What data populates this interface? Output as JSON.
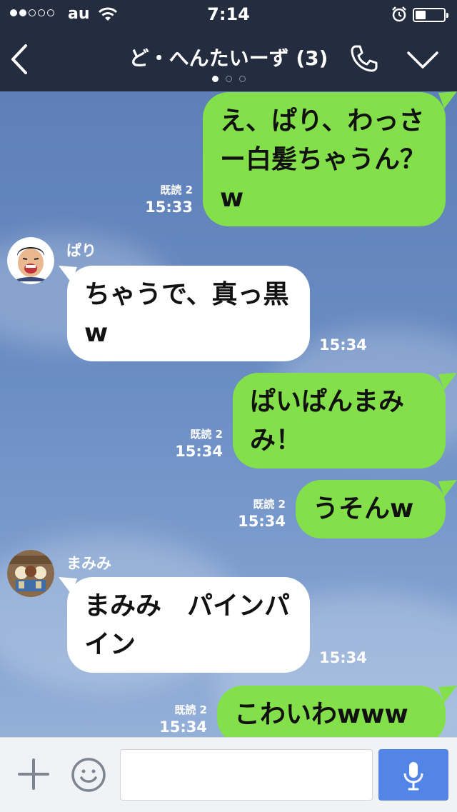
{
  "status_bar": {
    "carrier": "au",
    "time": "7:14"
  },
  "header": {
    "title": "ど・へんたいーず (3)"
  },
  "messages": [
    {
      "side": "out",
      "text": "え、ぱり、わっさー白髪ちゃうん？w",
      "read": "既読 2",
      "time": "15:33"
    },
    {
      "side": "in",
      "sender": "ぱり",
      "text": "ちゃうで、真っ黒w",
      "time": "15:34"
    },
    {
      "side": "out",
      "text": "ぱいぱんまみみ！",
      "read": "既読 2",
      "time": "15:34"
    },
    {
      "side": "out",
      "text": "うそんw",
      "read": "既読 2",
      "time": "15:34"
    },
    {
      "side": "in",
      "sender": "まみみ",
      "text": "まみみ　パインパイン",
      "time": "15:34"
    },
    {
      "side": "out",
      "text": "こわいわwww",
      "read": "既読 2",
      "time": "15:34"
    }
  ],
  "input": {
    "placeholder": ""
  },
  "colors": {
    "header_bg": "#242c3f",
    "outgoing_bubble": "#84e04a",
    "incoming_bubble": "#ffffff",
    "mic_button": "#5385e6"
  },
  "icons": [
    "back-chevron-icon",
    "phone-icon",
    "chevron-down-icon",
    "plus-icon",
    "emoji-icon",
    "microphone-icon",
    "wifi-icon",
    "alarm-icon",
    "battery-icon"
  ]
}
